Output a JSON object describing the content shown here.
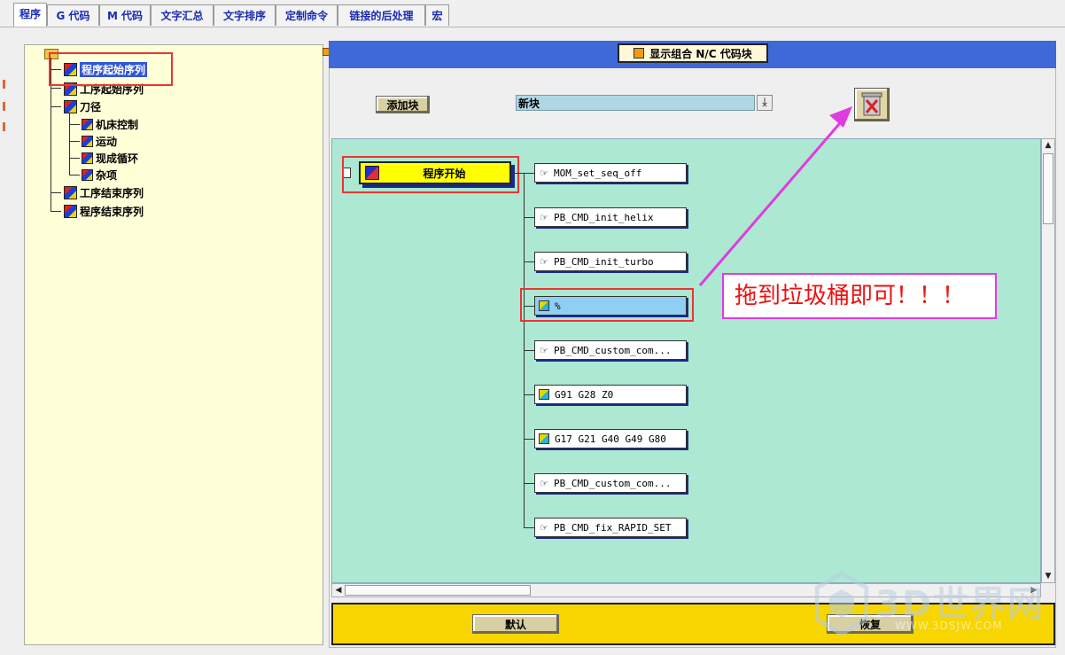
{
  "tabs": [
    "程序",
    "G 代码",
    "M 代码",
    "文字汇总",
    "文字排序",
    "定制命令",
    "链接的后处理",
    "宏"
  ],
  "active_tab": 0,
  "tree": {
    "items": [
      {
        "label": "程序起始序列",
        "selected": true
      },
      {
        "label": "工序起始序列"
      },
      {
        "label": "刀径"
      },
      {
        "label": "机床控制"
      },
      {
        "label": "运动"
      },
      {
        "label": "现成循环"
      },
      {
        "label": "杂项"
      },
      {
        "label": "工序结束序列"
      },
      {
        "label": "程序结束序列"
      }
    ]
  },
  "header": {
    "display_combined_label": "显示组合 N/C 代码块"
  },
  "toolbar": {
    "add_block_label": "添加块",
    "new_block_value": "新块"
  },
  "canvas": {
    "start_block_label": "程序开始",
    "blocks": [
      {
        "label": "MOM_set_seq_off",
        "icon": "hand-icon"
      },
      {
        "label": "PB_CMD_init_helix",
        "icon": "hand-icon"
      },
      {
        "label": "PB_CMD_init_turbo",
        "icon": "hand-icon"
      },
      {
        "label": "%",
        "icon": "block-cube-icon",
        "highlighted": true
      },
      {
        "label": "PB_CMD_custom_com...",
        "icon": "hand-icon"
      },
      {
        "label": "G91 G28 Z0",
        "icon": "block-cube-icon"
      },
      {
        "label": "G17 G21 G40 G49 G80",
        "icon": "block-cube-icon"
      },
      {
        "label": "PB_CMD_custom_com...",
        "icon": "hand-icon"
      },
      {
        "label": "PB_CMD_fix_RAPID_SET",
        "icon": "hand-icon"
      }
    ]
  },
  "annotation": {
    "text": "拖到垃圾桶即可！！！",
    "color": "#e03be0"
  },
  "footer": {
    "default_label": "默认",
    "restore_label": "恢复"
  },
  "watermark": {
    "main": "3D世界网",
    "sub": "WWW.3DSJW.COM"
  },
  "colors": {
    "header_bar": "#3f69d9",
    "canvas_bg": "#ade8d2",
    "footer_bg": "#f7d500",
    "tree_bg": "#ffffd8",
    "start_block": "#ffff00",
    "highlight_red": "#e33333"
  }
}
